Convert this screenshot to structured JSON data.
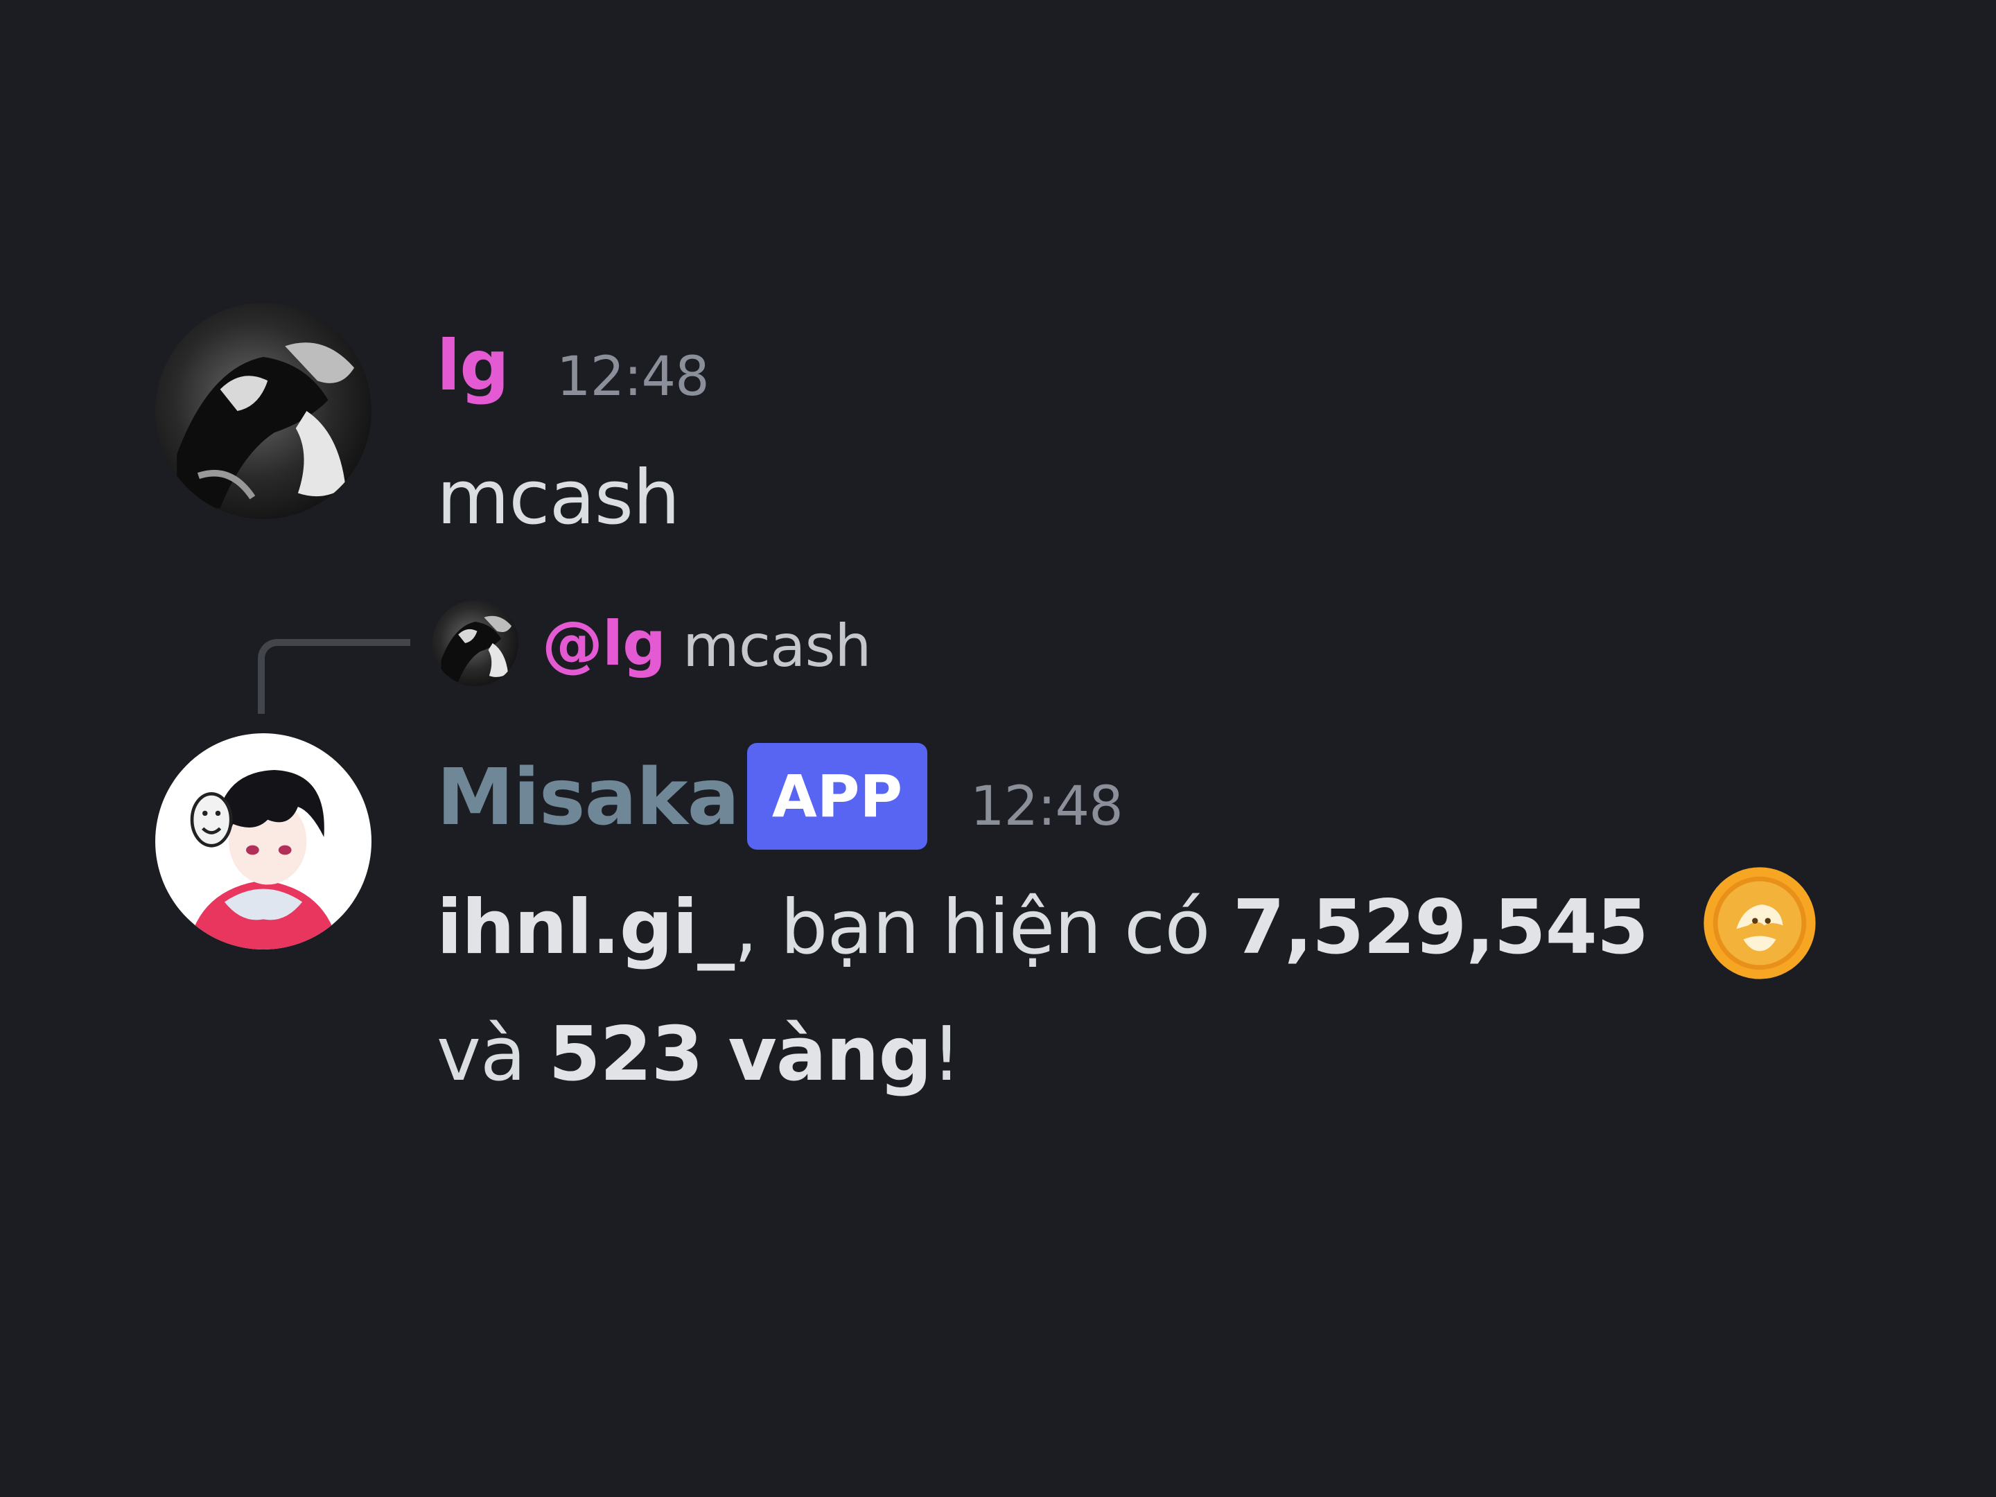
{
  "messages": [
    {
      "author": "lg",
      "author_color": "#e35ad3",
      "timestamp": "12:48",
      "content": "mcash",
      "avatar_icon": "user-avatar-photo"
    },
    {
      "reply_to": {
        "mention": "@lg",
        "content": "mcash",
        "avatar_icon": "user-avatar-photo"
      },
      "author": "Misaka",
      "author_color": "#6f8796",
      "badge": "APP",
      "badge_color": "#5865f2",
      "timestamp": "12:48",
      "content": {
        "user": "ihnl.gi_",
        "text_1": ", bạn hiện có ",
        "amount": "7,529,545",
        "coin_icon": "coin-icon",
        "text_2": "và ",
        "gold": "523 vàng",
        "text_3": "!"
      },
      "avatar_icon": "bot-avatar-anime"
    }
  ],
  "colors": {
    "background": "#1c1d22",
    "text": "#dbdee1",
    "timestamp": "#8b8f99"
  }
}
